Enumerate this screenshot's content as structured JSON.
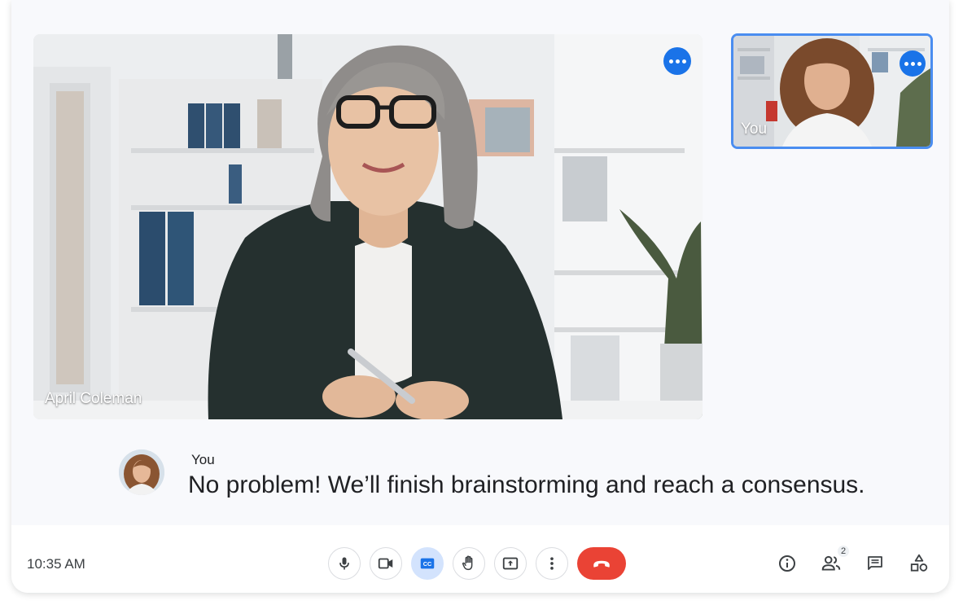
{
  "main_video": {
    "participant_name": "April Coleman",
    "more_options_icon": "more-horiz-icon"
  },
  "self_view": {
    "label": "You",
    "more_options_icon": "more-horiz-icon"
  },
  "caption": {
    "speaker": "You",
    "text": "No problem! We’ll finish brainstorming and reach a consensus."
  },
  "bottom_bar": {
    "time": "10:35 AM",
    "controls": [
      {
        "name": "microphone",
        "icon": "mic-icon"
      },
      {
        "name": "camera",
        "icon": "videocam-icon"
      },
      {
        "name": "captions",
        "icon": "closed-caption-icon",
        "active": true
      },
      {
        "name": "raise-hand",
        "icon": "hand-icon"
      },
      {
        "name": "present",
        "icon": "present-screen-icon"
      },
      {
        "name": "more-options",
        "icon": "more-vert-icon"
      },
      {
        "name": "end-call",
        "icon": "call-end-icon"
      }
    ],
    "right_controls": {
      "people_count": "2"
    }
  },
  "colors": {
    "accent": "#1a73e8",
    "end_call": "#ea4335",
    "captions_active_bg": "#d3e3fd"
  }
}
